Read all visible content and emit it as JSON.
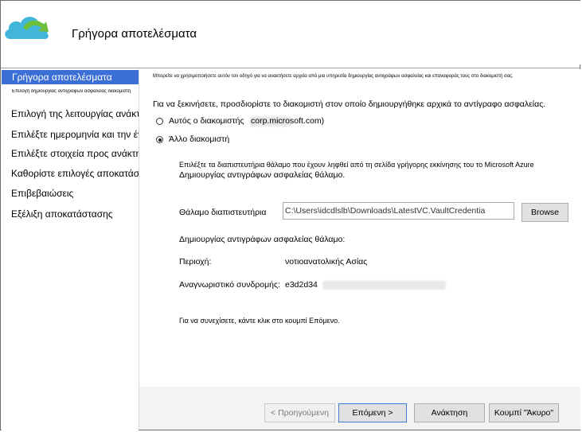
{
  "window": {
    "title": "Γρήγορα αποτελέσματα",
    "colors": {
      "accent": "#3c6fd6",
      "logo_cloud": "#41b6d8",
      "logo_arrow": "#6fbf3b"
    }
  },
  "sidebar": {
    "items": [
      {
        "label": "Γρήγορα αποτελέσματα",
        "active": true
      },
      {
        "label": "Επιλογή δημιουργίας αντιγράφων ασφαλείας διακομιστή",
        "sub": true
      },
      {
        "label": "Επιλογή της λειτουργίας ανάκτησης"
      },
      {
        "label": "Επιλέξτε ημερομηνία και την ένταση"
      },
      {
        "label": "Επιλέξτε στοιχεία προς ανάκτηση"
      },
      {
        "label": "Καθορίστε επιλογές αποκατάστασης"
      },
      {
        "label": "Επιβεβαιώσεις"
      },
      {
        "label": "Εξέλιξη αποκατάστασης"
      }
    ]
  },
  "main": {
    "intro": "Μπορείτε να χρησιμοποιήσετε αυτόν τον οδηγό για να ανακτήσετε αρχεία από μια υπηρεσία δημιουργίας αντιγράφων ασφαλείας και επαναφοράς τους στο διακομιστή σας.",
    "prompt": "Για να ξεκινήσετε, προσδιορίστε το διακομιστή στον οποίο δημιουργήθηκε αρχικά το αντίγραφο ασφαλείας.",
    "radio_this_server_label": "Αυτός ο διακομιστής",
    "radio_this_server_suffix": "corp.microsoft.com)",
    "radio_other_server_label": "Άλλο διακομιστή",
    "instruction_line1": "Επιλέξτε τα διαπιστευτήρια θάλαμο που έχουν ληφθεί από τη σελίδα γρήγορης εκκίνησης του το Microsoft Azure",
    "instruction_line2": "Δημιουργίας αντιγράφων ασφαλείας θάλαμο.",
    "vault_credentials_label": "Θάλαμο διαπιστευτήρια",
    "vault_credentials_value": "C:\\Users\\idcdlslb\\Downloads\\LatestVC.VaultCredentia",
    "browse_label": "Browse",
    "backup_vault_label": "Δημιουργίας αντιγράφων ασφαλείας θάλαμο:",
    "region_label": "Περιοχή:",
    "region_value": "νοτιοανατολικής Ασίας",
    "subscription_label": "Αναγνωριστικό συνδρομής:",
    "subscription_value": "e3d2d34",
    "continue_text": "Για να συνεχίσετε, κάντε κλικ στο κουμπί Επόμενο."
  },
  "footer": {
    "previous_label": "< Προηγούμενη",
    "next_label": "Επόμενη >",
    "recover_label": "Ανάκτηση",
    "cancel_label": "Κουμπί \"Άκυρο\""
  }
}
